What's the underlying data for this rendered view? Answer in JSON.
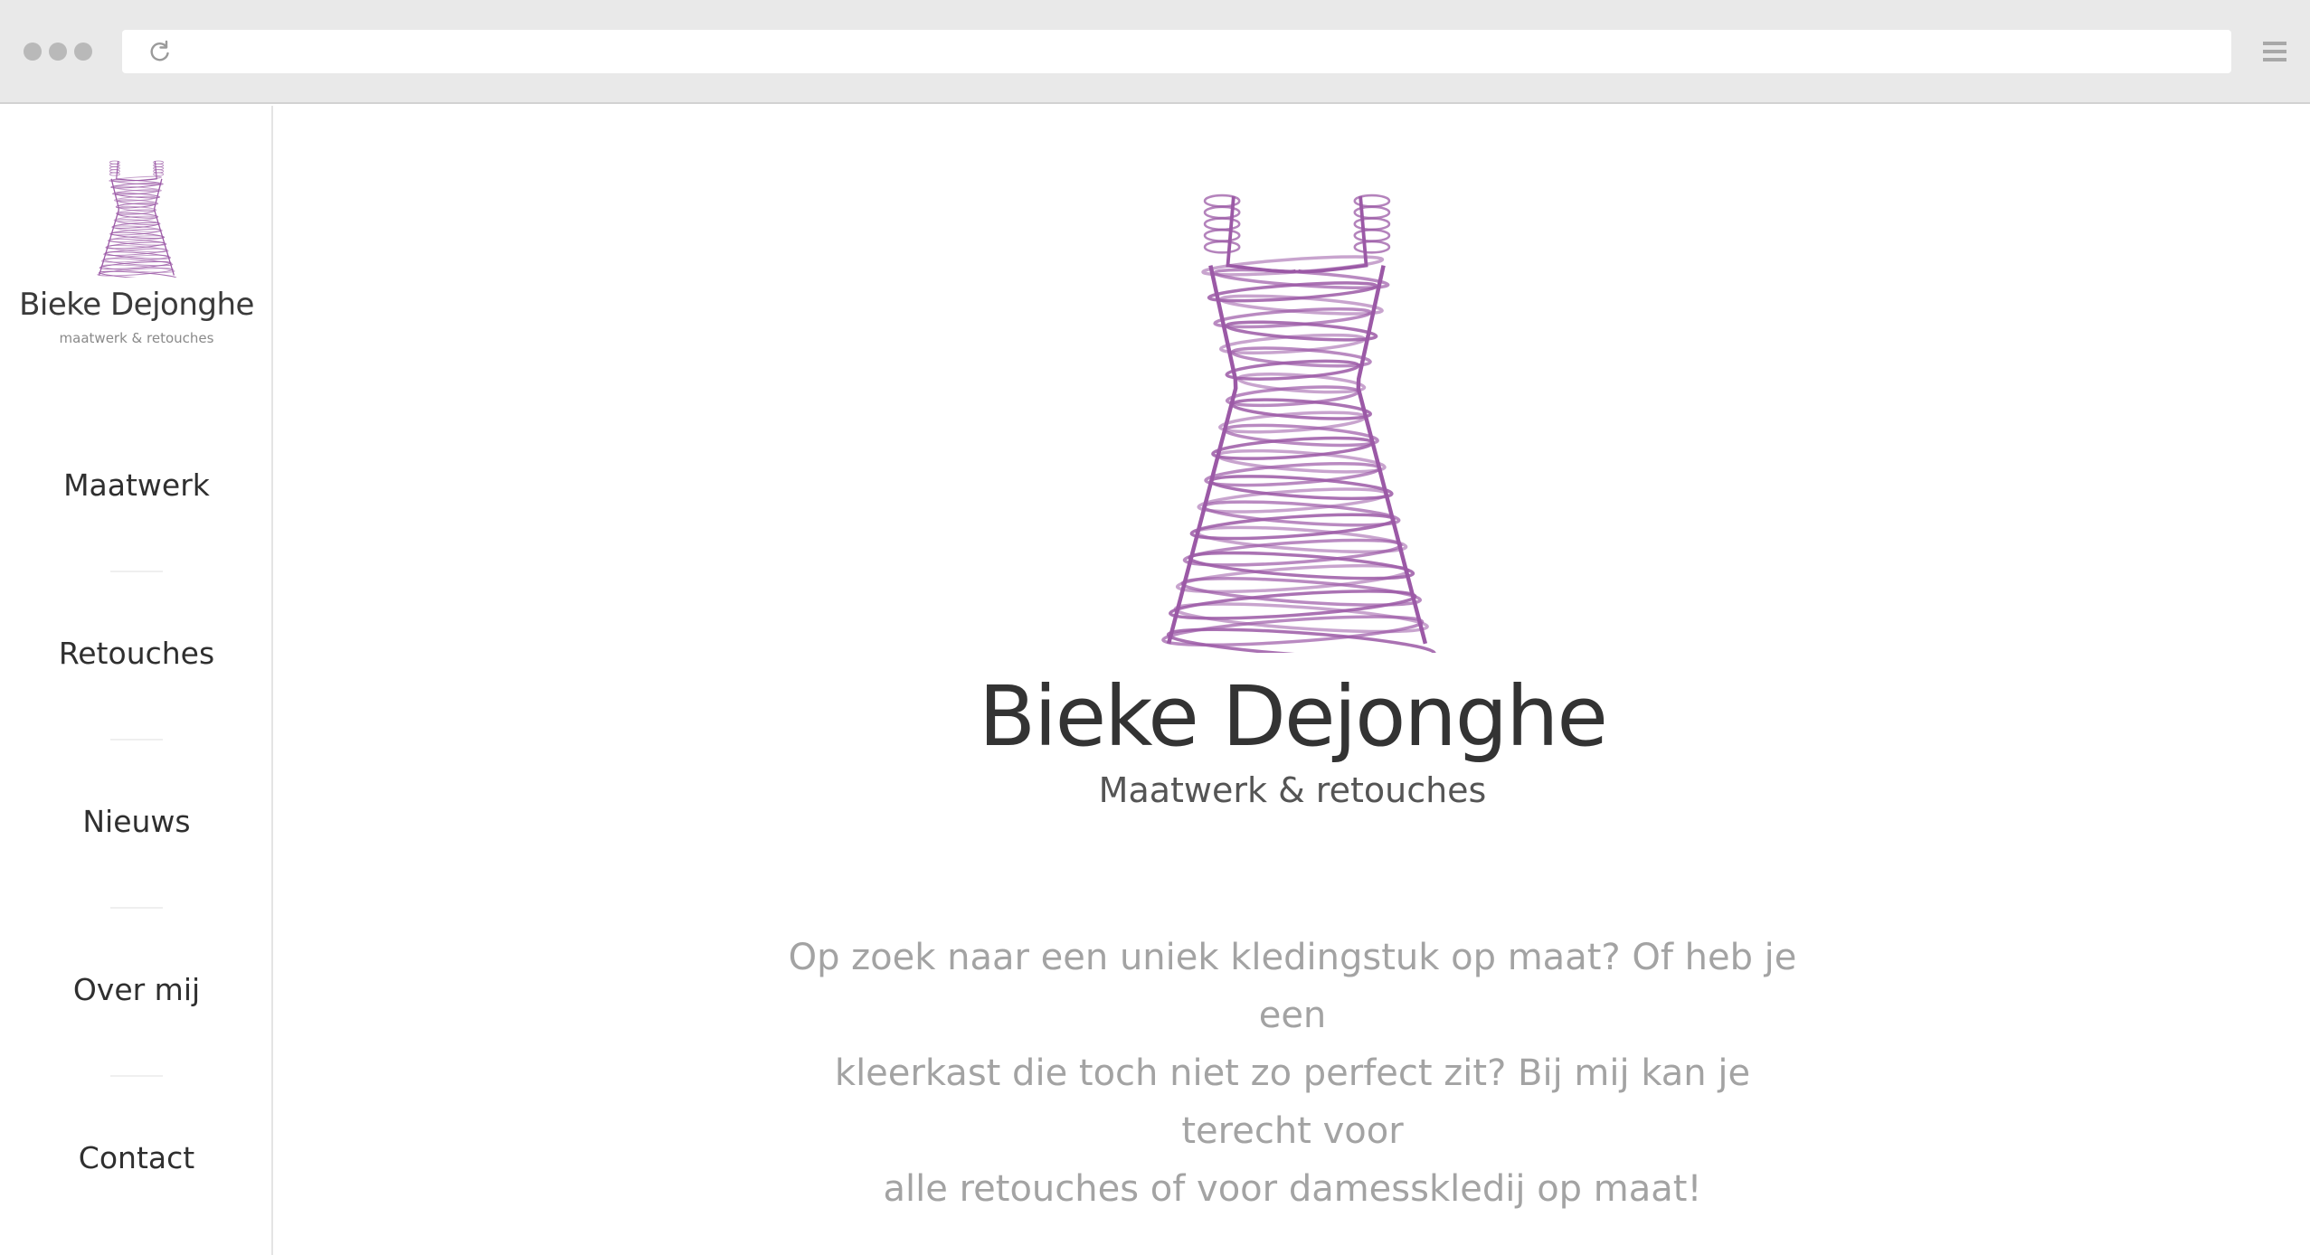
{
  "browser": {
    "url": "",
    "reload_icon": "reload-icon",
    "menu_icon": "hamburger-menu-icon"
  },
  "brand": {
    "name": "Bieke Dejonghe",
    "sidebar_tagline": "maatwerk & retouches",
    "hero_tagline": "Maatwerk & retouches",
    "logo_icon": "dress-icon",
    "accent_color": "#9b59a6"
  },
  "nav": {
    "items": [
      {
        "label": "Maatwerk"
      },
      {
        "label": "Retouches"
      },
      {
        "label": "Nieuws"
      },
      {
        "label": "Over mij"
      },
      {
        "label": "Contact"
      }
    ]
  },
  "main": {
    "intro_lines": [
      "Op zoek naar een uniek kledingstuk op maat? Of heb je een",
      "kleerkast die toch niet zo perfect zit? Bij mij kan je terecht voor",
      "alle retouches of voor damesskledij op maat!"
    ]
  }
}
